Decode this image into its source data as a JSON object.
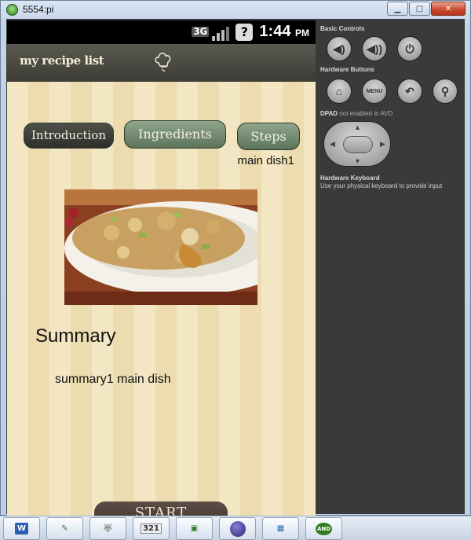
{
  "window": {
    "title": "5554:pi"
  },
  "status_bar": {
    "network": "3G",
    "time": "1:44",
    "ampm": "PM"
  },
  "app_bar": {
    "title": "my recipe list"
  },
  "tabs": [
    {
      "label": "Introduction"
    },
    {
      "label": "Ingredients"
    },
    {
      "label": "Steps"
    }
  ],
  "content": {
    "dish_name": "main dish1",
    "summary_title": "Summary",
    "summary_text": "summary1 main dish",
    "start_label": "START"
  },
  "controls": {
    "basic_title": "Basic Controls",
    "hardware_title": "Hardware Buttons",
    "menu_label": "MENU",
    "dpad_title": "DPAD",
    "dpad_note": "not enabled in AVD",
    "keyboard_title": "Hardware Keyboard",
    "keyboard_note": "Use your physical keyboard to provide input"
  },
  "taskbar": {
    "calendar_label": "321",
    "android_label": "AND"
  }
}
